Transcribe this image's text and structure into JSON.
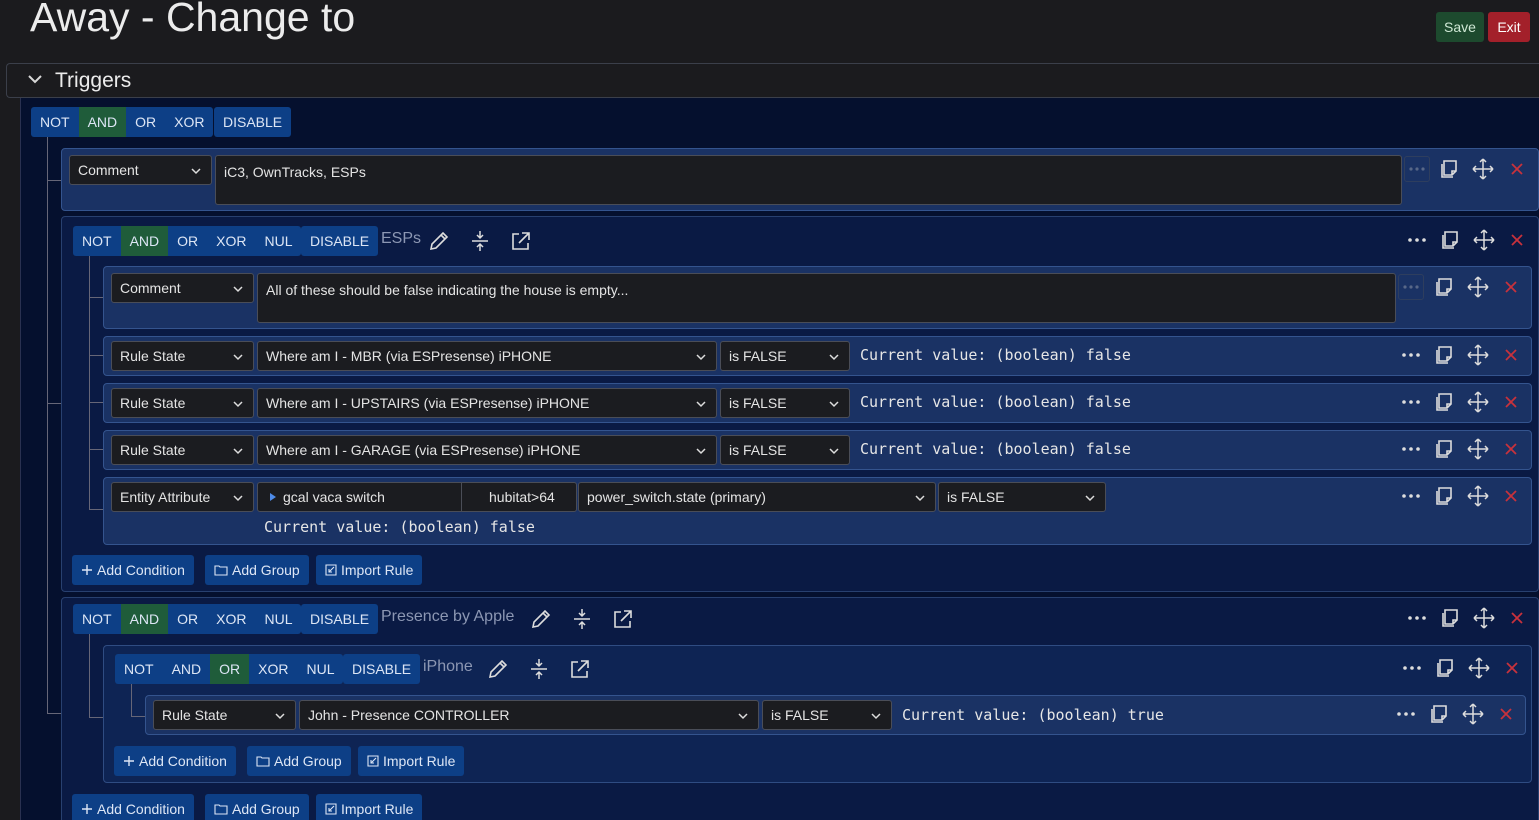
{
  "page": {
    "title": "Away - Change to",
    "save_label": "Save",
    "exit_label": "Exit"
  },
  "triggers": {
    "label": "Triggers"
  },
  "logic_ops": {
    "not": "NOT",
    "and": "AND",
    "or": "OR",
    "xor": "XOR",
    "nul": "NUL",
    "disable": "DISABLE"
  },
  "add": {
    "condition": "Add Condition",
    "group": "Add Group",
    "import": "Import Rule"
  },
  "top_comment": {
    "type": "Comment",
    "text": "iC3, OwnTracks, ESPs"
  },
  "esps_group": {
    "name": "ESPs",
    "comment": {
      "type": "Comment",
      "text": "All of these should be false indicating the house is empty..."
    },
    "rules": [
      {
        "type": "Rule State",
        "target": "Where am I - MBR (via ESPresense) iPHONE",
        "op": "is FALSE",
        "current": "Current value: (boolean) false"
      },
      {
        "type": "Rule State",
        "target": "Where am I - UPSTAIRS (via ESPresense) iPHONE",
        "op": "is FALSE",
        "current": "Current value: (boolean) false"
      },
      {
        "type": "Rule State",
        "target": "Where am I - GARAGE (via ESPresense) iPHONE",
        "op": "is FALSE",
        "current": "Current value: (boolean) false"
      }
    ],
    "entity": {
      "type": "Entity Attribute",
      "entity": "gcal vaca switch",
      "source": "hubitat>64",
      "attribute": "power_switch.state (primary)",
      "op": "is FALSE",
      "current": "Current value: (boolean) false"
    }
  },
  "presence_group": {
    "name": "Presence by Apple",
    "iphone_group": {
      "name": "iPhone",
      "rule": {
        "type": "Rule State",
        "target": "John - Presence CONTROLLER",
        "op": "is FALSE",
        "current": "Current value: (boolean) true"
      }
    }
  },
  "colors": {
    "save": "#1d4a2e",
    "exit": "#a3202a",
    "op_active": "#1f5c3a",
    "op": "#0d3f86",
    "delete": "#c8323c"
  }
}
